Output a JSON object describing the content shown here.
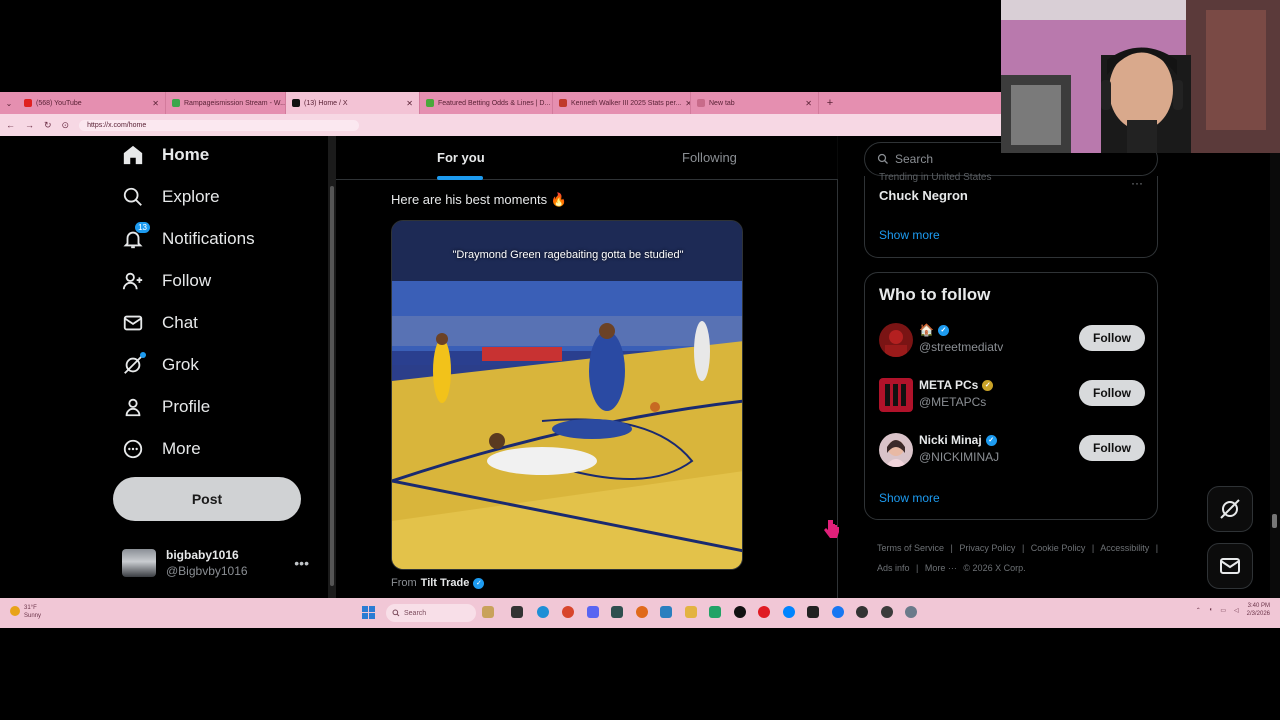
{
  "browser": {
    "tabs": [
      {
        "title": "(568) YouTube",
        "color": "#e02020",
        "active": false
      },
      {
        "title": "Rampageismission Stream - W...",
        "color": "#3aa64b",
        "active": false
      },
      {
        "title": "(13) Home / X",
        "color": "#111111",
        "active": true
      },
      {
        "title": "Featured Betting Odds & Lines | D...",
        "color": "#4aa83a",
        "active": false
      },
      {
        "title": "Kenneth Walker III 2025 Stats per...",
        "color": "#c0392b",
        "active": false
      },
      {
        "title": "New tab",
        "color": "#c86b8a",
        "active": false
      }
    ],
    "url": "https://x.com/home"
  },
  "nav": {
    "items": [
      {
        "label": "Home",
        "icon": "home-icon"
      },
      {
        "label": "Explore",
        "icon": "search-icon"
      },
      {
        "label": "Notifications",
        "icon": "bell-icon",
        "badge": "13"
      },
      {
        "label": "Follow",
        "icon": "add-person-icon"
      },
      {
        "label": "Chat",
        "icon": "envelope-icon"
      },
      {
        "label": "Grok",
        "icon": "grok-icon"
      },
      {
        "label": "Profile",
        "icon": "person-icon"
      },
      {
        "label": "More",
        "icon": "more-circle-icon"
      }
    ],
    "post_label": "Post",
    "account": {
      "name": "bigbaby1016",
      "handle": "@Bigbvby1016"
    }
  },
  "feed": {
    "tabs": [
      "For you",
      "Following"
    ],
    "active_tab": "For you",
    "tweet_text": "Here are his best moments 🔥",
    "media_caption": "\"Draymond Green ragebaiting gotta be studied\"",
    "from_label": "From",
    "from_source": "Tilt Trade"
  },
  "sidebar": {
    "search_placeholder": "Search",
    "trend_context": "Trending in United States",
    "trend_name": "Chuck Negron",
    "show_more": "Show more",
    "who_to_follow": {
      "title": "Who to follow",
      "users": [
        {
          "name": "🏠",
          "handle": "@streetmediatv",
          "verified": "blue",
          "follow": "Follow"
        },
        {
          "name": "META PCs",
          "handle": "@METAPCs",
          "verified": "gold",
          "follow": "Follow"
        },
        {
          "name": "Nicki Minaj",
          "handle": "@NICKIMINAJ",
          "verified": "blue",
          "follow": "Follow"
        }
      ],
      "show_more": "Show more"
    },
    "footer": [
      "Terms of Service",
      "|",
      "Privacy Policy",
      "|",
      "Cookie Policy",
      "|",
      "Accessibility",
      "|",
      "Ads info",
      "|",
      "More ···",
      "© 2026 X Corp."
    ]
  },
  "taskbar": {
    "weather_temp": "31°F",
    "weather_desc": "Sunny",
    "search_label": "Search",
    "time": "3:40 PM",
    "date": "2/3/2026"
  }
}
